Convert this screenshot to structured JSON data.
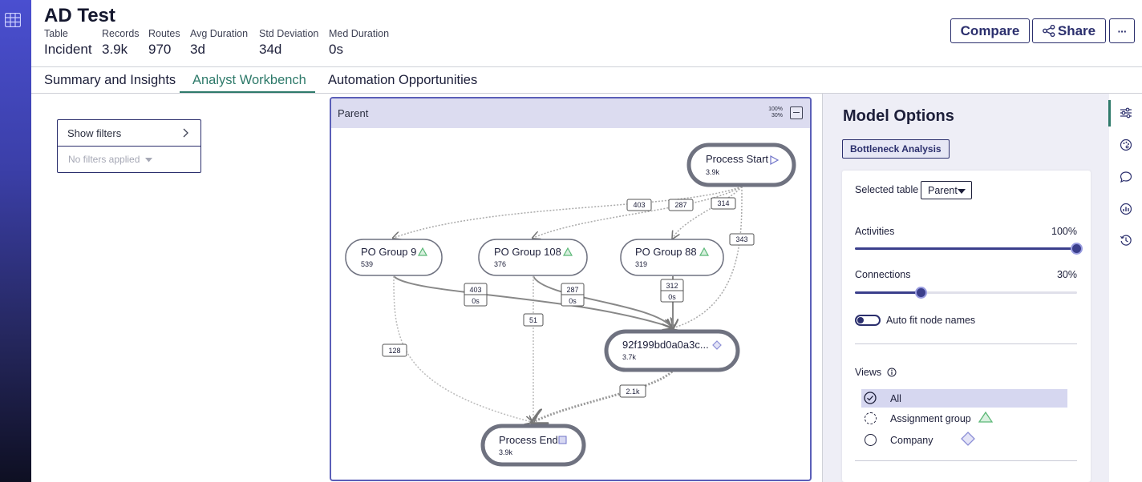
{
  "app": {
    "title": "AD Test"
  },
  "stats": [
    {
      "label": "Table",
      "value": "Incident"
    },
    {
      "label": "Records",
      "value": "3.9k"
    },
    {
      "label": "Routes",
      "value": "970"
    },
    {
      "label": "Avg Duration",
      "value": "3d"
    },
    {
      "label": "Std Deviation",
      "value": "34d"
    },
    {
      "label": "Med Duration",
      "value": "0s"
    }
  ],
  "header_actions": {
    "compare": "Compare",
    "share": "Share",
    "more": "···"
  },
  "tabs": [
    {
      "label": "Summary and Insights",
      "active": false
    },
    {
      "label": "Analyst Workbench",
      "active": true
    },
    {
      "label": "Automation Opportunities",
      "active": false
    }
  ],
  "filters": {
    "show": "Show filters",
    "none": "No filters applied"
  },
  "canvas": {
    "title": "Parent",
    "activities_pct": "100%",
    "connections_pct": "30%",
    "nodes": {
      "start": {
        "name": "Process Start",
        "count": "3.9k"
      },
      "g9": {
        "name": "PO Group 9",
        "count": "539"
      },
      "g108": {
        "name": "PO Group 108",
        "count": "376"
      },
      "g88": {
        "name": "PO Group 88",
        "count": "319"
      },
      "company": {
        "name": "92f199bd0a0a3c...",
        "count": "3.7k"
      },
      "end": {
        "name": "Process End",
        "count": "3.9k"
      }
    },
    "edge_labels": {
      "s_g9": "403",
      "s_g108": "287",
      "s_g88": "314",
      "s_company": "343",
      "g9_company_a": "403",
      "g9_company_b": "0s",
      "g108_company_a": "287",
      "g108_company_b": "0s",
      "g88_company_a": "312",
      "g88_company_b": "0s",
      "g108_end": "51",
      "g9_end": "128",
      "company_end": "2.1k"
    }
  },
  "model_options": {
    "title": "Model Options",
    "mode": "Bottleneck Analysis",
    "selected_table_label": "Selected table",
    "selected_table_value": "Parent",
    "activities_label": "Activities",
    "activities_value": "100%",
    "activities_level": 1.0,
    "connections_label": "Connections",
    "connections_value": "30%",
    "connections_level": 0.3,
    "auto_fit_label": "Auto fit node names",
    "views_label": "Views",
    "views": [
      {
        "label": "All",
        "selected": true
      },
      {
        "label": "Assignment group",
        "selected": false
      },
      {
        "label": "Company",
        "selected": false
      }
    ]
  },
  "colors": {
    "accent": "#2b2f6d",
    "active_tab": "#2e7a6a",
    "group_marker": "#5cb877",
    "company_marker": "#8c8fd6"
  },
  "icons": [
    "grid-icon",
    "share-icon",
    "info-icon",
    "sliders-icon",
    "palette-icon",
    "chat-icon",
    "chart-icon",
    "history-icon",
    "chevron-right-icon",
    "caret-down-icon"
  ]
}
